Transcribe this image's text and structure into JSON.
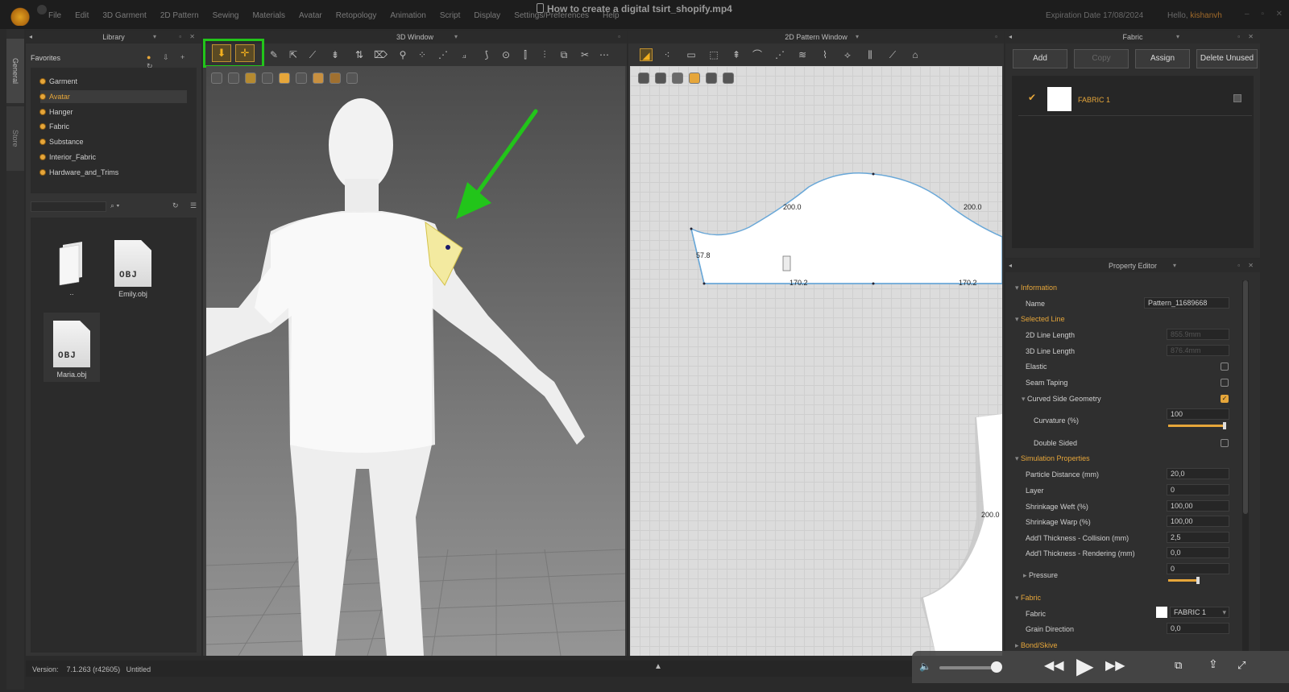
{
  "video_title": "How to create a digital tsirt_shopify.mp4",
  "menu": [
    "File",
    "Edit",
    "3D Garment",
    "2D Pattern",
    "Sewing",
    "Materials",
    "Avatar",
    "Retopology",
    "Animation",
    "Script",
    "Display",
    "Settings/Preferences",
    "Help"
  ],
  "expiration": "Expiration Date 17/08/2024",
  "hello_prefix": "Hello,",
  "hello_user": "kishanvh",
  "side_tabs": [
    "General",
    "Store"
  ],
  "library": {
    "title": "Library",
    "favorites_label": "Favorites",
    "items": [
      "Garment",
      "Avatar",
      "Hanger",
      "Fabric",
      "Substance",
      "Interior_Fabric",
      "Hardware_and_Trims"
    ],
    "selected": "Avatar",
    "files": [
      {
        "name": "..",
        "type": "folder"
      },
      {
        "name": "Emily.obj",
        "type": "obj"
      },
      {
        "name": "Maria.obj",
        "type": "obj"
      }
    ],
    "obj_badge": "OBJ"
  },
  "window3d": {
    "title": "3D Window"
  },
  "window2d": {
    "title": "2D Pattern Window",
    "measurements": {
      "top_left": "200.0",
      "top_right": "200.0",
      "left_side": "57.8",
      "bottom_left": "170.2",
      "bottom_right": "170.2",
      "lower_right": "200.0"
    }
  },
  "fabric_panel": {
    "title": "Fabric",
    "buttons": {
      "add": "Add",
      "copy": "Copy",
      "assign": "Assign",
      "delete": "Delete Unused"
    },
    "item": {
      "name": "FABRIC 1",
      "checked": true
    }
  },
  "property_editor": {
    "title": "Property Editor",
    "information": "Information",
    "name_label": "Name",
    "name_value": "Pattern_11689668",
    "selected_line": "Selected Line",
    "line2d_label": "2D Line Length",
    "line2d_value": "855.9mm",
    "line3d_label": "3D Line Length",
    "line3d_value": "876.4mm",
    "elastic_label": "Elastic",
    "seam_taping_label": "Seam Taping",
    "curved_label": "Curved Side Geometry",
    "curvature_label": "Curvature (%)",
    "curvature_value": "100",
    "curvature_fraction": 1.0,
    "double_sided_label": "Double Sided",
    "sim_props": "Simulation Properties",
    "particle_label": "Particle Distance (mm)",
    "particle_value": "20,0",
    "layer_label": "Layer",
    "layer_value": "0",
    "weft_label": "Shrinkage Weft (%)",
    "weft_value": "100,00",
    "warp_label": "Shrinkage Warp (%)",
    "warp_value": "100,00",
    "collision_label": "Add'l Thickness - Collision (mm)",
    "collision_value": "2,5",
    "rendering_label": "Add'l Thickness - Rendering (mm)",
    "rendering_value": "0,0",
    "pressure_label": "Pressure",
    "pressure_value": "0",
    "fabric_section": "Fabric",
    "fabric_label": "Fabric",
    "fabric_value": "FABRIC 1",
    "grain_label": "Grain Direction",
    "grain_value": "0,0",
    "bond_section": "Bond/Skive"
  },
  "status": {
    "version_label": "Version:",
    "version_value": "7.1.263 (r42605)",
    "file": "Untitled"
  },
  "colors": {
    "accent": "#e6a63a",
    "highlight": "#22c51a",
    "sleeve": "#f3eaa0"
  }
}
